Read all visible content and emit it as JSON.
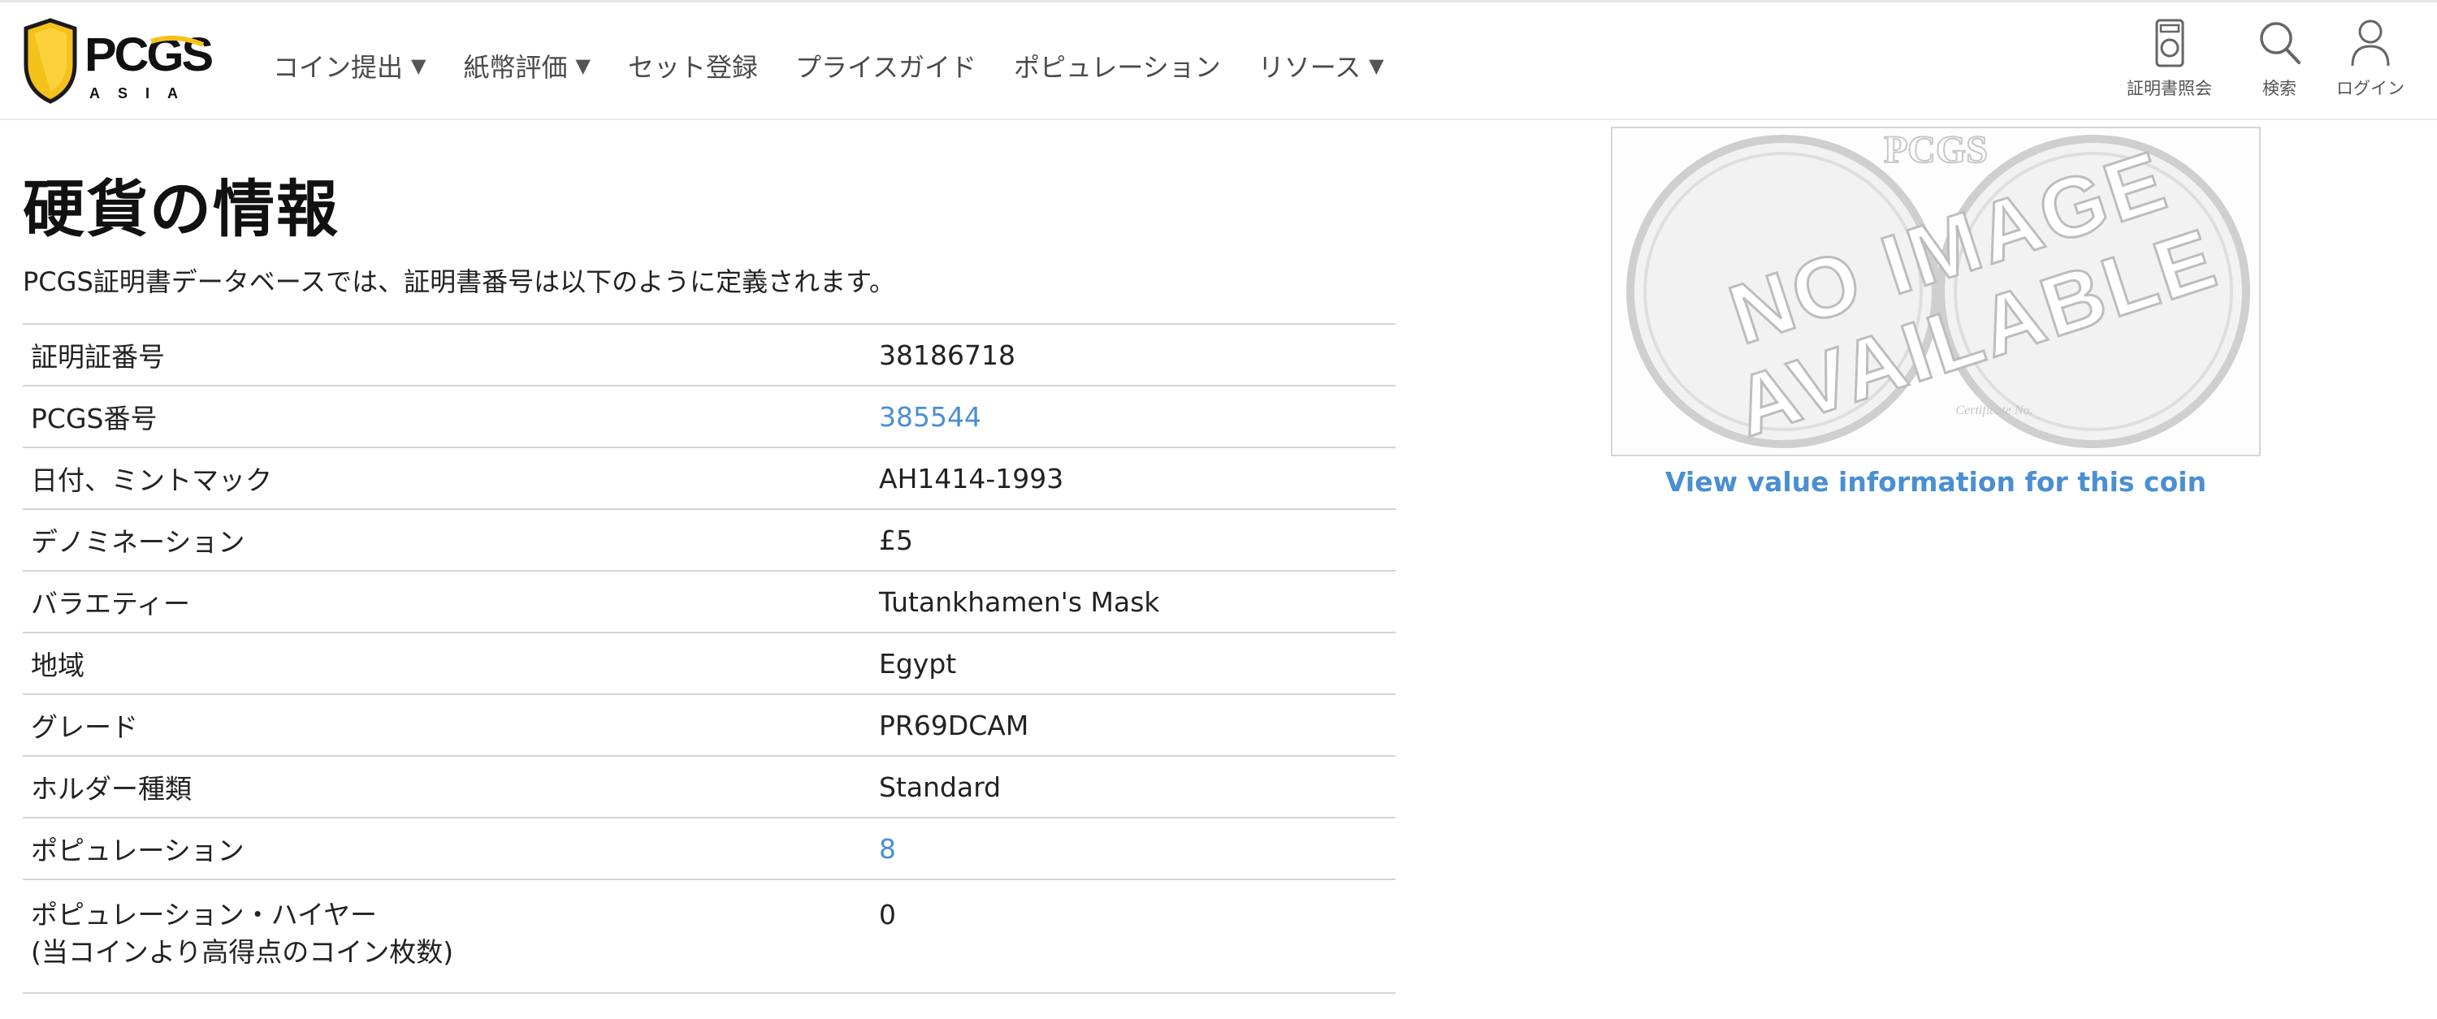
{
  "brand": {
    "logo_text": "PCGS",
    "logo_subtext": "ASIA",
    "shield_color": "#f5c21b"
  },
  "nav": {
    "items": [
      {
        "label": "コイン提出",
        "has_dropdown": true
      },
      {
        "label": "紙幣評価",
        "has_dropdown": true
      },
      {
        "label": "セット登録",
        "has_dropdown": false
      },
      {
        "label": "プライスガイド",
        "has_dropdown": false
      },
      {
        "label": "ポピュレーション",
        "has_dropdown": false
      },
      {
        "label": "リソース",
        "has_dropdown": true
      }
    ],
    "caret": "▼"
  },
  "utility": {
    "cert_lookup": {
      "label": "証明書照会",
      "icon": "certificate-icon"
    },
    "search": {
      "label": "検索",
      "icon": "search-icon"
    },
    "login": {
      "label": "ログイン",
      "icon": "user-icon"
    }
  },
  "page": {
    "title": "硬貨の情報",
    "intro": "PCGS証明書データベースでは、証明書番号は以下のように定義されます。"
  },
  "coin_info": {
    "rows": [
      {
        "label": "証明証番号",
        "value": "38186718",
        "is_link": false
      },
      {
        "label": "PCGS番号",
        "value": "385544",
        "is_link": true
      },
      {
        "label": "日付、ミントマック",
        "value": "AH1414-1993",
        "is_link": false
      },
      {
        "label": "デノミネーション",
        "value": "£5",
        "is_link": false
      },
      {
        "label": "バラエティー",
        "value": "Tutankhamen's Mask",
        "is_link": false
      },
      {
        "label": "地域",
        "value": "Egypt",
        "is_link": false
      },
      {
        "label": "グレード",
        "value": "PR69DCAM",
        "is_link": false
      },
      {
        "label": "ホルダー種類",
        "value": "Standard",
        "is_link": false
      },
      {
        "label": "ポピュレーション",
        "value": "8",
        "is_link": true
      }
    ],
    "pop_higher": {
      "label_line1": "ポピュレーション・ハイヤー",
      "label_line2": "(当コインより高得点のコイン枚数)",
      "value": "0"
    }
  },
  "coin_image": {
    "placeholder_line1": "NO IMAGE",
    "placeholder_line2": "AVAILABLE",
    "watermark": "PCGS",
    "cert_caption": "Certificate No."
  },
  "value_link": "View value information for this coin",
  "colors": {
    "link": "#4a8fd1",
    "title": "#111111",
    "border": "#d4d4d4"
  }
}
